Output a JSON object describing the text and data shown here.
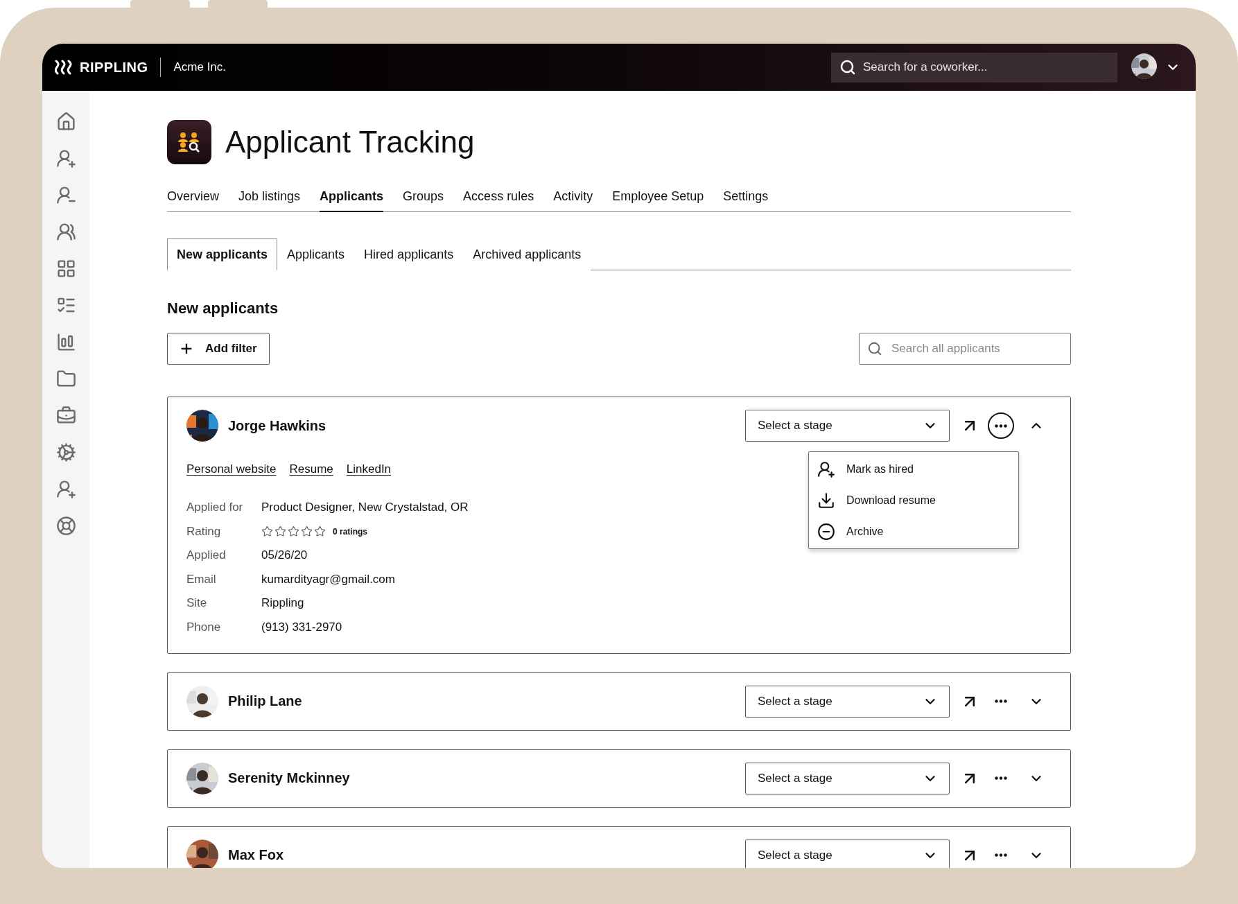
{
  "top_bar": {
    "brand": "RIPPLING",
    "company": "Acme Inc.",
    "search": {
      "placeholder": "Search for a coworker..."
    }
  },
  "page": {
    "title": "Applicant Tracking"
  },
  "tabs": [
    {
      "label": "Overview",
      "selected": false
    },
    {
      "label": "Job listings",
      "selected": false
    },
    {
      "label": "Applicants",
      "selected": true
    },
    {
      "label": "Groups",
      "selected": false
    },
    {
      "label": "Access rules",
      "selected": false
    },
    {
      "label": "Activity",
      "selected": false
    },
    {
      "label": "Employee Setup",
      "selected": false
    },
    {
      "label": "Settings",
      "selected": false
    }
  ],
  "subtabs": [
    {
      "label": "New applicants",
      "selected": true
    },
    {
      "label": "Applicants",
      "selected": false
    },
    {
      "label": "Hired applicants",
      "selected": false
    },
    {
      "label": "Archived applicants",
      "selected": false
    }
  ],
  "section_title": "New applicants",
  "add_filter": "Add filter",
  "search": {
    "placeholder": "Search all applicants"
  },
  "applicants": [
    {
      "name": "Jorge Hawkins",
      "expanded": true,
      "menu_open": true,
      "stage_placeholder": "Select a stage",
      "links": [
        "Personal website",
        "Resume",
        "LinkedIn"
      ],
      "details": [
        {
          "kind": "text",
          "label": "Applied for",
          "value": "Product Designer, New Crystalstad, OR"
        },
        {
          "kind": "rating",
          "label": "Rating",
          "stars": 0,
          "value": "0 ratings"
        },
        {
          "kind": "text",
          "label": "Applied",
          "value": "05/26/20"
        },
        {
          "kind": "text",
          "label": "Email",
          "value": "kumardityagr@gmail.com"
        },
        {
          "kind": "text",
          "label": "Site",
          "value": "Rippling"
        },
        {
          "kind": "text",
          "label": "Phone",
          "value": "(913) 331-2970"
        }
      ],
      "menu": [
        {
          "kind": "hire",
          "label": "Mark as hired"
        },
        {
          "kind": "download",
          "label": "Download resume"
        },
        {
          "kind": "archive",
          "label": "Archive"
        }
      ]
    },
    {
      "name": "Philip Lane",
      "expanded": false,
      "menu_open": false,
      "stage_placeholder": "Select a stage"
    },
    {
      "name": "Serenity Mckinney",
      "expanded": false,
      "menu_open": false,
      "stage_placeholder": "Select a stage"
    },
    {
      "name": "Max Fox",
      "expanded": false,
      "menu_open": false,
      "stage_placeholder": "Select a stage"
    }
  ]
}
